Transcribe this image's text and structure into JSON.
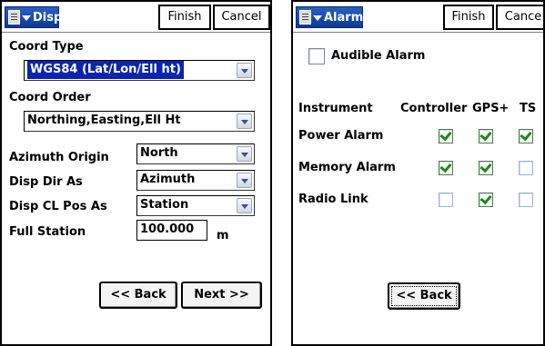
{
  "display": {
    "title": "Display",
    "finish": "Finish",
    "cancel": "Cancel",
    "coord_type_label": "Coord Type",
    "coord_type_value": "WGS84 (Lat/Lon/Ell ht)",
    "coord_order_label": "Coord Order",
    "coord_order_value": "Northing,Easting,Ell Ht",
    "azimuth_origin_label": "Azimuth Origin",
    "azimuth_origin_value": "North",
    "disp_dir_label": "Disp Dir As",
    "disp_dir_value": "Azimuth",
    "disp_cl_label": "Disp CL Pos As",
    "disp_cl_value": "Station",
    "full_station_label": "Full Station",
    "full_station_value": "100.000",
    "full_station_unit": "m",
    "back": "<< Back",
    "next": "Next >>"
  },
  "alarms": {
    "title": "Alarms",
    "finish": "Finish",
    "cancel": "Cance",
    "audible_label": "Audible Alarm",
    "audible_checked": false,
    "headers": [
      "Instrument",
      "Controller",
      "GPS+",
      "TS"
    ],
    "rows": [
      {
        "label": "Power Alarm",
        "checks": [
          true,
          true,
          true
        ]
      },
      {
        "label": "Memory Alarm",
        "checks": [
          true,
          true,
          false
        ]
      },
      {
        "label": "Radio Link",
        "checks": [
          false,
          true,
          false
        ]
      }
    ],
    "back": "<< Back"
  },
  "icons": {
    "start": "start-menu-icon",
    "dropdown": "chevron-down-icon",
    "check": "checkmark-icon"
  },
  "colors": {
    "titlebar": "#0b3a9a",
    "selection": "#0a24b0",
    "check": "#1c8a1c"
  }
}
